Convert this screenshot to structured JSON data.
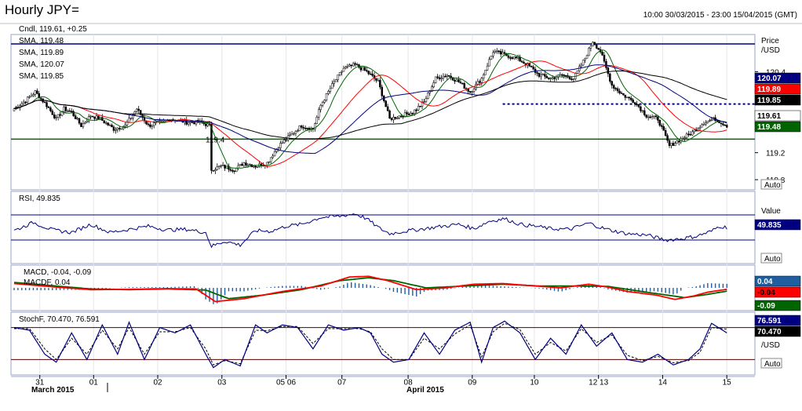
{
  "header": {
    "title": "Hourly JPY=",
    "date_range": "10:00 30/03/2015 - 23:00 15/04/2015 (GMT)"
  },
  "colors": {
    "frame": "#000080",
    "sma_fast": "#006400",
    "sma_mid": "#ff0000",
    "sma_slow": "#000080",
    "sma_long": "#000000",
    "macd": "#ff0000",
    "macd_signal": "#006400",
    "histogram": "#1f5fa0",
    "stoch_k": "#000080",
    "stoch_d": "#000000"
  },
  "chart_data": [
    {
      "type": "candlestick",
      "panel": "price",
      "legend": [
        {
          "label": "Cndl, 119.61, +0.25",
          "color": "#000000"
        },
        {
          "label": "SMA, 119.48",
          "color": "#006400"
        },
        {
          "label": "SMA, 119.89",
          "color": "#ff0000"
        },
        {
          "label": "SMA, 120.07",
          "color": "#000080"
        },
        {
          "label": "SMA, 119.85",
          "color": "#000000"
        }
      ],
      "axis_title": "Price",
      "axis_unit": "/USD",
      "y_ticks": [
        "120.4",
        "119.2",
        "118.8"
      ],
      "ylim": [
        118.65,
        120.95
      ],
      "auto_label": "Auto",
      "horizontal_lines": [
        {
          "value": 120.81,
          "style": "solid",
          "color": "#000080"
        },
        {
          "value": 119.4,
          "style": "solid",
          "color": "#006400",
          "label": "119.4"
        },
        {
          "value": 119.92,
          "style": "dashed",
          "color": "#000080"
        }
      ],
      "value_labels": [
        {
          "text": "120.07",
          "bg": "#000080",
          "fg": "#ffffff"
        },
        {
          "text": "119.89",
          "bg": "#ff0000",
          "fg": "#ffffff"
        },
        {
          "text": "119.85",
          "bg": "#000000",
          "fg": "#ffffff"
        },
        {
          "text": "119.61",
          "bg": "#ffffff",
          "fg": "#000000"
        },
        {
          "text": "119.48",
          "bg": "#006400",
          "fg": "#ffffff"
        }
      ],
      "close_anchors": [
        [
          0,
          119.85
        ],
        [
          5,
          119.95
        ],
        [
          11,
          120.1
        ],
        [
          17,
          119.9
        ],
        [
          22,
          119.7
        ],
        [
          26,
          119.85
        ],
        [
          30,
          119.8
        ],
        [
          35,
          119.6
        ],
        [
          40,
          119.75
        ],
        [
          45,
          119.7
        ],
        [
          52,
          119.55
        ],
        [
          58,
          119.6
        ],
        [
          64,
          119.85
        ],
        [
          70,
          119.6
        ],
        [
          76,
          119.65
        ],
        [
          82,
          119.7
        ],
        [
          90,
          119.65
        ],
        [
          97,
          119.65
        ],
        [
          102,
          119.6
        ],
        [
          103,
          118.95
        ],
        [
          108,
          119.0
        ],
        [
          115,
          118.95
        ],
        [
          120,
          119.05
        ],
        [
          126,
          119.0
        ],
        [
          132,
          119.05
        ],
        [
          138,
          119.3
        ],
        [
          144,
          119.45
        ],
        [
          150,
          119.6
        ],
        [
          156,
          119.55
        ],
        [
          160,
          119.9
        ],
        [
          166,
          120.2
        ],
        [
          172,
          120.45
        ],
        [
          178,
          120.5
        ],
        [
          184,
          120.4
        ],
        [
          190,
          120.25
        ],
        [
          196,
          119.7
        ],
        [
          202,
          119.75
        ],
        [
          208,
          119.8
        ],
        [
          214,
          119.95
        ],
        [
          220,
          120.3
        ],
        [
          226,
          120.35
        ],
        [
          232,
          120.25
        ],
        [
          238,
          120.1
        ],
        [
          244,
          120.3
        ],
        [
          250,
          120.7
        ],
        [
          256,
          120.65
        ],
        [
          262,
          120.6
        ],
        [
          268,
          120.5
        ],
        [
          274,
          120.35
        ],
        [
          280,
          120.3
        ],
        [
          286,
          120.35
        ],
        [
          292,
          120.3
        ],
        [
          298,
          120.6
        ],
        [
          302,
          120.85
        ],
        [
          306,
          120.7
        ],
        [
          312,
          120.2
        ],
        [
          318,
          120.05
        ],
        [
          324,
          119.95
        ],
        [
          330,
          119.75
        ],
        [
          336,
          119.7
        ],
        [
          342,
          119.3
        ],
        [
          348,
          119.4
        ],
        [
          354,
          119.5
        ],
        [
          360,
          119.65
        ],
        [
          366,
          119.7
        ],
        [
          372,
          119.6
        ]
      ],
      "candle_count": 373
    },
    {
      "type": "line",
      "panel": "rsi",
      "legend": [
        {
          "label": "RSI, 49.835",
          "color": "#000080"
        }
      ],
      "axis_title": "Value",
      "ylim": [
        0,
        100
      ],
      "y_ticks_visible": [],
      "horizontal_lines": [
        70,
        30
      ],
      "value_labels": [
        {
          "text": "49.835",
          "bg": "#000080",
          "fg": "#ffffff"
        }
      ],
      "auto_label": "Auto",
      "values_anchors": [
        [
          0,
          45
        ],
        [
          10,
          58
        ],
        [
          20,
          46
        ],
        [
          30,
          42
        ],
        [
          40,
          55
        ],
        [
          50,
          42
        ],
        [
          60,
          47
        ],
        [
          70,
          52
        ],
        [
          80,
          46
        ],
        [
          90,
          47
        ],
        [
          100,
          42
        ],
        [
          103,
          20
        ],
        [
          110,
          28
        ],
        [
          118,
          22
        ],
        [
          126,
          45
        ],
        [
          134,
          44
        ],
        [
          142,
          52
        ],
        [
          150,
          55
        ],
        [
          160,
          66
        ],
        [
          170,
          68
        ],
        [
          178,
          72
        ],
        [
          184,
          64
        ],
        [
          190,
          50
        ],
        [
          196,
          40
        ],
        [
          204,
          44
        ],
        [
          214,
          48
        ],
        [
          224,
          52
        ],
        [
          232,
          55
        ],
        [
          240,
          48
        ],
        [
          248,
          60
        ],
        [
          256,
          64
        ],
        [
          264,
          55
        ],
        [
          272,
          52
        ],
        [
          280,
          48
        ],
        [
          290,
          47
        ],
        [
          300,
          57
        ],
        [
          306,
          50
        ],
        [
          312,
          45
        ],
        [
          320,
          40
        ],
        [
          330,
          38
        ],
        [
          340,
          30
        ],
        [
          348,
          32
        ],
        [
          356,
          36
        ],
        [
          364,
          44
        ],
        [
          368,
          52
        ],
        [
          372,
          50
        ]
      ]
    },
    {
      "type": "line",
      "panel": "macd",
      "legend": [
        {
          "label": "MACD, -0.04, -0.09",
          "color": "#ff0000"
        },
        {
          "label": "MACDF, 0.04",
          "color": "#1f5fa0"
        }
      ],
      "ylim": [
        -0.5,
        0.5
      ],
      "value_labels": [
        {
          "text": "0.04",
          "bg": "#1f5fa0",
          "fg": "#ffffff"
        },
        {
          "text": "-0.04",
          "bg": "#ff0000",
          "fg": "#000000"
        },
        {
          "text": "-0.09",
          "bg": "#006400",
          "fg": "#ffffff"
        }
      ],
      "macd_anchors": [
        [
          0,
          0.12
        ],
        [
          20,
          0.03
        ],
        [
          40,
          -0.05
        ],
        [
          60,
          -0.04
        ],
        [
          80,
          -0.02
        ],
        [
          95,
          -0.03
        ],
        [
          105,
          -0.38
        ],
        [
          120,
          -0.3
        ],
        [
          140,
          -0.1
        ],
        [
          160,
          0.05
        ],
        [
          175,
          0.3
        ],
        [
          185,
          0.32
        ],
        [
          195,
          0.2
        ],
        [
          210,
          -0.05
        ],
        [
          225,
          0.0
        ],
        [
          240,
          0.1
        ],
        [
          255,
          0.12
        ],
        [
          270,
          0.06
        ],
        [
          285,
          0.0
        ],
        [
          300,
          0.1
        ],
        [
          310,
          0.02
        ],
        [
          320,
          -0.1
        ],
        [
          335,
          -0.2
        ],
        [
          345,
          -0.32
        ],
        [
          355,
          -0.22
        ],
        [
          362,
          -0.12
        ],
        [
          372,
          -0.04
        ]
      ],
      "signal_anchors": [
        [
          0,
          0.15
        ],
        [
          20,
          0.06
        ],
        [
          40,
          -0.03
        ],
        [
          60,
          -0.05
        ],
        [
          80,
          -0.03
        ],
        [
          100,
          -0.06
        ],
        [
          112,
          -0.3
        ],
        [
          130,
          -0.2
        ],
        [
          150,
          -0.05
        ],
        [
          170,
          0.2
        ],
        [
          185,
          0.28
        ],
        [
          198,
          0.2
        ],
        [
          215,
          0.0
        ],
        [
          235,
          0.05
        ],
        [
          255,
          0.1
        ],
        [
          275,
          0.05
        ],
        [
          295,
          0.05
        ],
        [
          310,
          0.04
        ],
        [
          330,
          -0.12
        ],
        [
          350,
          -0.27
        ],
        [
          362,
          -0.18
        ],
        [
          372,
          -0.09
        ]
      ]
    },
    {
      "type": "line",
      "panel": "stochastic",
      "legend": [
        {
          "label": "StochF, 70.470, 76.591",
          "color": "#000080"
        }
      ],
      "ylim": [
        0,
        100
      ],
      "horizontal_lines": [
        80,
        20
      ],
      "axis_unit": "/USD",
      "value_labels": [
        {
          "text": "76.591",
          "bg": "#000080",
          "fg": "#ffffff"
        },
        {
          "text": "70.470",
          "bg": "#000000",
          "fg": "#ffffff"
        }
      ],
      "auto_label": "Auto",
      "k_anchors": [
        [
          0,
          80
        ],
        [
          8,
          75
        ],
        [
          16,
          30
        ],
        [
          22,
          15
        ],
        [
          30,
          70
        ],
        [
          38,
          20
        ],
        [
          46,
          85
        ],
        [
          54,
          30
        ],
        [
          60,
          90
        ],
        [
          68,
          20
        ],
        [
          76,
          80
        ],
        [
          84,
          70
        ],
        [
          92,
          85
        ],
        [
          100,
          30
        ],
        [
          104,
          5
        ],
        [
          110,
          20
        ],
        [
          118,
          8
        ],
        [
          126,
          85
        ],
        [
          132,
          70
        ],
        [
          140,
          85
        ],
        [
          148,
          80
        ],
        [
          156,
          40
        ],
        [
          164,
          85
        ],
        [
          172,
          75
        ],
        [
          180,
          80
        ],
        [
          186,
          70
        ],
        [
          192,
          30
        ],
        [
          198,
          15
        ],
        [
          206,
          20
        ],
        [
          214,
          70
        ],
        [
          222,
          30
        ],
        [
          230,
          75
        ],
        [
          238,
          90
        ],
        [
          244,
          15
        ],
        [
          250,
          80
        ],
        [
          256,
          92
        ],
        [
          264,
          70
        ],
        [
          272,
          20
        ],
        [
          280,
          60
        ],
        [
          288,
          30
        ],
        [
          296,
          85
        ],
        [
          304,
          45
        ],
        [
          312,
          70
        ],
        [
          320,
          20
        ],
        [
          328,
          15
        ],
        [
          336,
          30
        ],
        [
          344,
          10
        ],
        [
          352,
          20
        ],
        [
          358,
          40
        ],
        [
          364,
          88
        ],
        [
          372,
          70
        ]
      ],
      "d_anchors": [
        [
          0,
          78
        ],
        [
          8,
          78
        ],
        [
          16,
          40
        ],
        [
          22,
          20
        ],
        [
          30,
          60
        ],
        [
          38,
          30
        ],
        [
          46,
          75
        ],
        [
          54,
          40
        ],
        [
          60,
          80
        ],
        [
          68,
          30
        ],
        [
          76,
          72
        ],
        [
          84,
          72
        ],
        [
          92,
          80
        ],
        [
          100,
          40
        ],
        [
          104,
          10
        ],
        [
          110,
          18
        ],
        [
          118,
          12
        ],
        [
          126,
          75
        ],
        [
          132,
          74
        ],
        [
          140,
          82
        ],
        [
          148,
          82
        ],
        [
          156,
          50
        ],
        [
          164,
          78
        ],
        [
          172,
          78
        ],
        [
          180,
          78
        ],
        [
          186,
          72
        ],
        [
          192,
          40
        ],
        [
          198,
          20
        ],
        [
          206,
          20
        ],
        [
          214,
          60
        ],
        [
          222,
          40
        ],
        [
          230,
          68
        ],
        [
          238,
          85
        ],
        [
          244,
          25
        ],
        [
          250,
          72
        ],
        [
          256,
          88
        ],
        [
          264,
          76
        ],
        [
          272,
          30
        ],
        [
          280,
          52
        ],
        [
          288,
          36
        ],
        [
          296,
          78
        ],
        [
          304,
          52
        ],
        [
          312,
          66
        ],
        [
          320,
          28
        ],
        [
          328,
          18
        ],
        [
          336,
          26
        ],
        [
          344,
          14
        ],
        [
          352,
          18
        ],
        [
          358,
          34
        ],
        [
          364,
          80
        ],
        [
          372,
          77
        ]
      ]
    }
  ],
  "x_axis": {
    "day_labels": [
      "31",
      "01",
      "02",
      "03",
      "05 06",
      "07",
      "08",
      "09",
      "10",
      "12 13",
      "14",
      "15"
    ],
    "day_positions": [
      5,
      31,
      62,
      93,
      124,
      151,
      183,
      214,
      244,
      275,
      306,
      337
    ],
    "month_labels": [
      "March 2015",
      "April 2015"
    ]
  }
}
